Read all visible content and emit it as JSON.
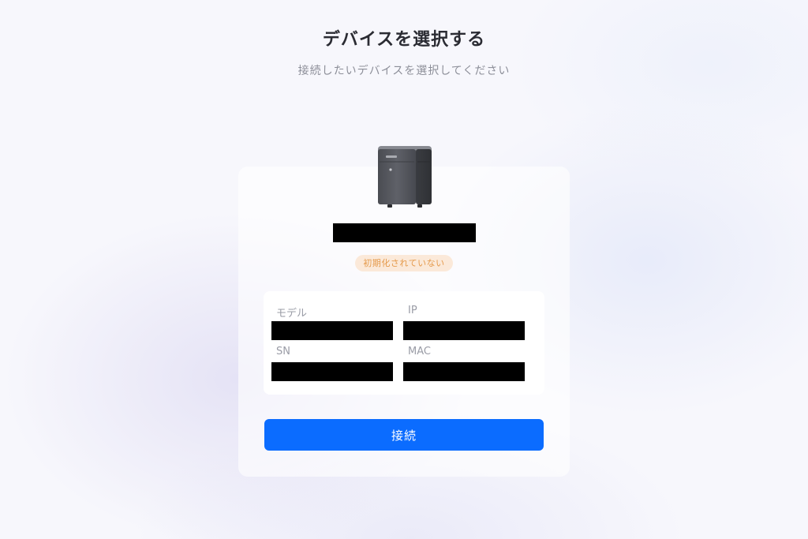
{
  "header": {
    "title": "デバイスを選択する",
    "subtitle": "接続したいデバイスを選択してください"
  },
  "device": {
    "image_icon": "device-box-icon",
    "name_redacted": true,
    "status": "初期化されていない",
    "status_color": "#e59a4b",
    "info": {
      "model_label": "モデル",
      "ip_label": "IP",
      "sn_label": "SN",
      "mac_label": "MAC",
      "values_redacted": true
    }
  },
  "actions": {
    "connect_label": "接続",
    "accent_color": "#0b6cff"
  }
}
